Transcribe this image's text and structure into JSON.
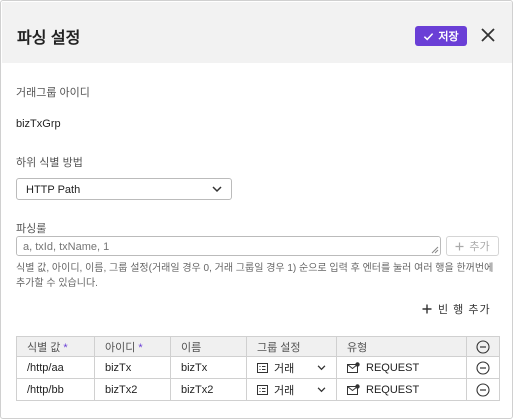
{
  "header": {
    "title": "파싱 설정",
    "save_label": "저장"
  },
  "form": {
    "group_id_label": "거래그룹 아이디",
    "group_id_value": "bizTxGrp",
    "sub_id_method_label": "하위 식별 방법",
    "sub_id_method_value": "HTTP Path",
    "parsing_rule_label": "파싱룰",
    "parsing_rule_placeholder": "a, txId, txName, 1",
    "add_label": "추가",
    "help_text": "식별 값, 아이디, 이름, 그룹 설정(거래일 경우 0, 거래 그룹일 경우 1) 순으로 입력 후 엔터를 눌러 여러 행을 한꺼번에 추가할 수 있습니다.",
    "add_empty_row_label": "빈 행 추가"
  },
  "table": {
    "columns": {
      "id_value": "식별 값",
      "id": "아이디",
      "name": "이름",
      "group_setting": "그룹 설정",
      "type": "유형"
    },
    "required_mark": "*",
    "rows": [
      {
        "id_value": "/http/aa",
        "id": "bizTx",
        "name": "bizTx",
        "group_setting": "거래",
        "type": "REQUEST"
      },
      {
        "id_value": "/http/bb",
        "id": "bizTx2",
        "name": "bizTx2",
        "group_setting": "거래",
        "type": "REQUEST"
      }
    ]
  },
  "colors": {
    "accent": "#6a3fd6",
    "header_bg": "#f2f2f2"
  },
  "icons": {
    "save": "check-icon",
    "close": "close-icon",
    "dropdown": "chevron-down-icon",
    "add": "plus-icon",
    "group": "list-icon",
    "type": "mail-icon",
    "remove": "minus-circle-icon"
  }
}
